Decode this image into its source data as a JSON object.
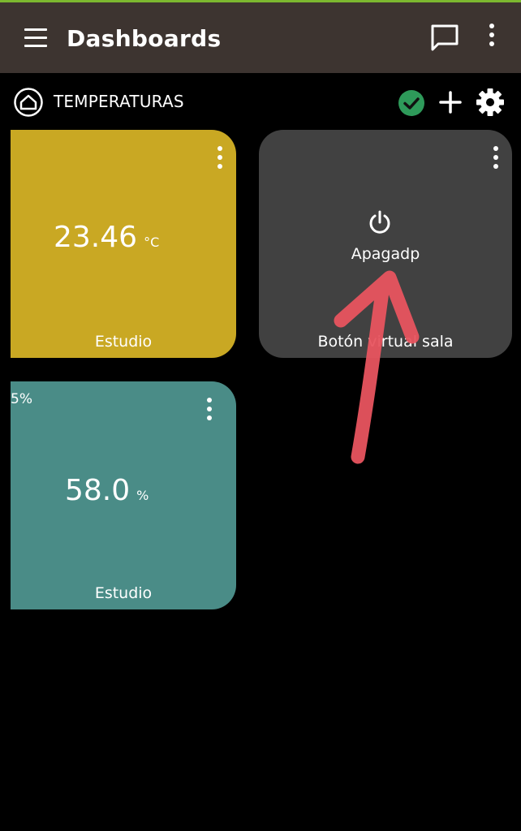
{
  "header": {
    "title": "Dashboards"
  },
  "dashboard": {
    "name": "TEMPERATURAS"
  },
  "tiles": [
    {
      "value": "23.46",
      "unit": "°C",
      "label": "Estudio",
      "color": "#c9a823"
    },
    {
      "state": "Apagadp",
      "label": "Botón virtual sala",
      "color": "#414141"
    },
    {
      "value": "58.0",
      "unit": "%",
      "label": "Estudio",
      "corner_text": "5%",
      "color": "#4a8c87"
    }
  ],
  "colors": {
    "appbar": "#3d3430",
    "accent_line": "#7cb82f",
    "check": "#2e9a5a",
    "annotation_arrow": "#e8545f"
  },
  "icons": [
    "menu-icon",
    "chat-icon",
    "more-vert-icon",
    "home-icon",
    "check-circle-icon",
    "plus-icon",
    "gear-icon",
    "power-icon"
  ]
}
